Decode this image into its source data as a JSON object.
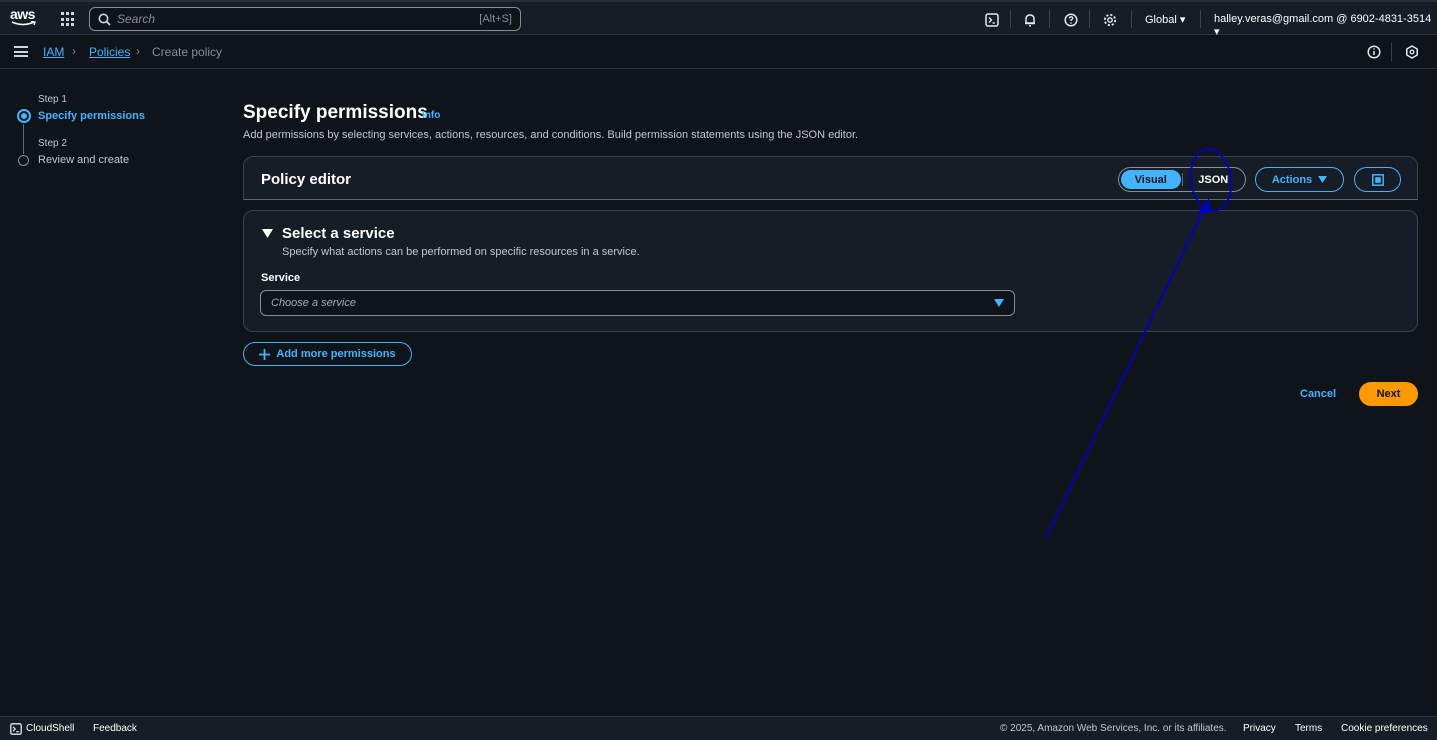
{
  "topnav": {
    "logo_text": "aws",
    "search_placeholder": "Search",
    "search_shortcut": "[Alt+S]",
    "region": "Global ▾",
    "account": "halley.veras@gmail.com @ 6902-4831-3514 ▾",
    "icons": [
      "apps-grid-icon",
      "search-icon",
      "cloudshell-icon",
      "bell-icon",
      "help-icon",
      "gear-icon"
    ]
  },
  "breadcrumb": {
    "items": [
      "IAM",
      "Policies",
      "Create policy"
    ],
    "right_icons": [
      "info-circle-icon",
      "hexagon-settings-icon"
    ]
  },
  "steps": [
    {
      "step": "Step 1",
      "label": "Specify permissions",
      "active": true
    },
    {
      "step": "Step 2",
      "label": "Review and create",
      "active": false
    }
  ],
  "main": {
    "title": "Specify permissions",
    "info": "Info",
    "description": "Add permissions by selecting services, actions, resources, and conditions. Build permission statements using the JSON editor."
  },
  "policy_editor": {
    "title": "Policy editor",
    "mode_visual": "Visual",
    "mode_json": "JSON",
    "selected_mode": "Visual",
    "actions_label": "Actions"
  },
  "service_section": {
    "title": "Select a service",
    "description": "Specify what actions can be performed on specific resources in a service.",
    "field_label": "Service",
    "placeholder": "Choose a service"
  },
  "add_permissions_label": "Add more permissions",
  "buttons": {
    "cancel": "Cancel",
    "next": "Next"
  },
  "footer": {
    "cloudshell": "CloudShell",
    "feedback": "Feedback",
    "copyright": "© 2025, Amazon Web Services, Inc. or its affiliates.",
    "privacy": "Privacy",
    "terms": "Terms",
    "cookies": "Cookie preferences"
  },
  "colors": {
    "accent": "#42b4ff",
    "primary_button": "#ff9900",
    "background": "#0f141a",
    "annotation": "#0000cc"
  }
}
